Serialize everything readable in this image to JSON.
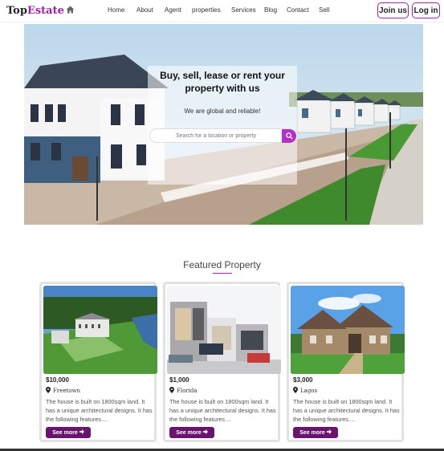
{
  "header": {
    "logo_main": "Top",
    "logo_accent": "Estate",
    "logo_icon": "house-icon",
    "nav": [
      "Home",
      "About",
      "Agent",
      "properties",
      "Services",
      "Blog",
      "Contact",
      "Sell"
    ],
    "join_label": "Join us",
    "login_label": "Log in"
  },
  "hero": {
    "title": "Buy, sell, lease or rent your property with us",
    "subtitle": "We are global and reliable!",
    "search_placeholder": "Search for a location or property",
    "search_icon": "search-icon"
  },
  "featured": {
    "title": "Featured Property"
  },
  "cards": [
    {
      "price": "$10,000",
      "location": "Freetown",
      "description": "The house is built on 1800sqm land. It has a unique architectural designs. It has the following features....",
      "button": "See more"
    },
    {
      "price": "$1,000",
      "location": "Florida",
      "description": "The house is built on 1800sqm land. It has a unique architectural designs. It has the following features....",
      "button": "See more"
    },
    {
      "price": "$3,000",
      "location": "Lagos",
      "description": "The house is built on 1800sqm land. It has a unique architectural designs. It has the following features....",
      "button": "See more"
    }
  ],
  "colors": {
    "accent": "#a020a8",
    "button": "#6a1470"
  }
}
